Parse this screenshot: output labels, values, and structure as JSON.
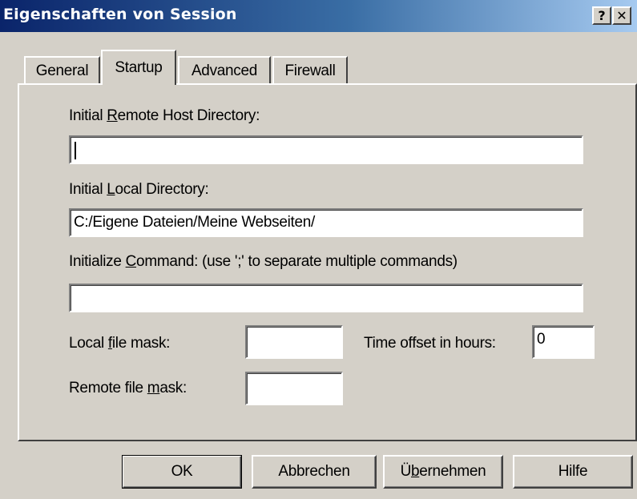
{
  "window": {
    "title": "Eigenschaften von Session",
    "help_button": "?",
    "close_button": "✕"
  },
  "tabs": [
    {
      "label": "General",
      "selected": false
    },
    {
      "label": "Startup",
      "selected": true
    },
    {
      "label": "Advanced",
      "selected": false
    },
    {
      "label": "Firewall",
      "selected": false
    }
  ],
  "startup": {
    "remote_dir": {
      "label_pre": "Initial ",
      "label_key": "R",
      "label_post": "emote Host Directory:",
      "value": ""
    },
    "local_dir": {
      "label_pre": "Initial ",
      "label_key": "L",
      "label_post": "ocal Directory:",
      "value": "C:/Eigene Dateien/Meine Webseiten/"
    },
    "init_command": {
      "label_pre": "Initialize ",
      "label_key": "C",
      "label_post": "ommand: (use ';' to separate multiple commands)",
      "value": ""
    },
    "local_mask": {
      "label_pre": "Local ",
      "label_key": "f",
      "label_post": "ile mask:",
      "value": ""
    },
    "remote_mask": {
      "label_pre": "Remote file ",
      "label_key": "m",
      "label_post": "ask:",
      "value": ""
    },
    "time_offset": {
      "label": "Time offset in hours:",
      "value": "0"
    }
  },
  "buttons": {
    "ok": "OK",
    "cancel": "Abbrechen",
    "apply_pre": "Ü",
    "apply_key": "b",
    "apply_post": "ernehmen",
    "help": "Hilfe"
  },
  "colors": {
    "title_gradient_start": "#0a246a",
    "title_gradient_end": "#a6caf0",
    "face": "#d4d0c8"
  }
}
